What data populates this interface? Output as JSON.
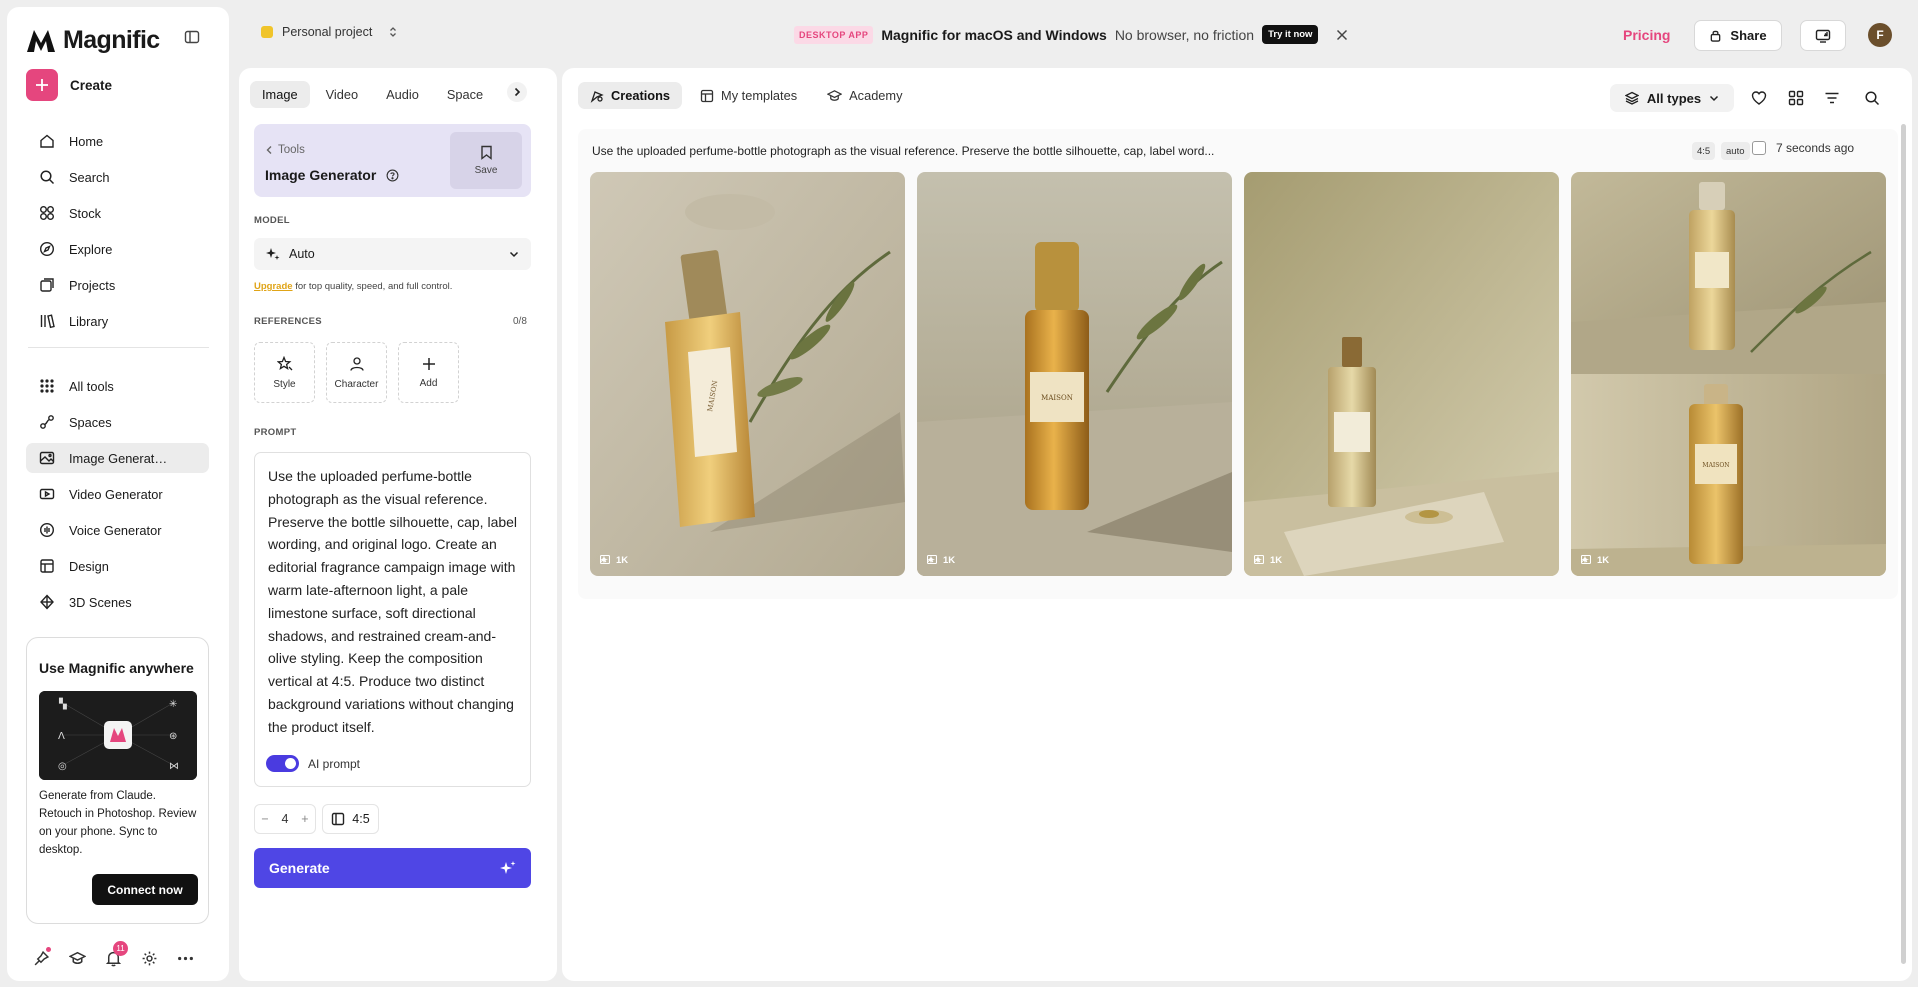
{
  "app": {
    "name": "Magnific",
    "create_label": "Create"
  },
  "sidebar": {
    "nav_primary": [
      {
        "label": "Home",
        "icon": "home-icon"
      },
      {
        "label": "Search",
        "icon": "search-icon"
      },
      {
        "label": "Stock",
        "icon": "stock-icon"
      },
      {
        "label": "Explore",
        "icon": "explore-icon"
      },
      {
        "label": "Projects",
        "icon": "projects-icon"
      },
      {
        "label": "Library",
        "icon": "library-icon"
      }
    ],
    "nav_secondary": [
      {
        "label": "All tools",
        "icon": "grid-icon"
      },
      {
        "label": "Spaces",
        "icon": "spaces-icon"
      },
      {
        "label": "Image Generat…",
        "icon": "image-icon",
        "active": true
      },
      {
        "label": "Video Generator",
        "icon": "video-icon"
      },
      {
        "label": "Voice Generator",
        "icon": "voice-icon"
      },
      {
        "label": "Design",
        "icon": "design-icon"
      },
      {
        "label": "3D Scenes",
        "icon": "3d-icon"
      }
    ],
    "promo": {
      "title": "Use Magnific anywhere",
      "text": "Generate from Claude. Retouch in Photoshop. Review on your phone. Sync to desktop.",
      "button": "Connect now"
    },
    "notifications_count": "11"
  },
  "topbar": {
    "project": "Personal project",
    "banner_tag": "DESKTOP APP",
    "banner_title": "Magnific for macOS and Windows",
    "banner_sub": "No browser, no friction",
    "banner_cta": "Try it now",
    "pricing": "Pricing",
    "share": "Share",
    "avatar_initial": "F"
  },
  "tools": {
    "tabs": [
      "Image",
      "Video",
      "Audio",
      "Spaces"
    ],
    "active_tab": "Image",
    "breadcrumb": "Tools",
    "tool_name": "Image Generator",
    "save": "Save",
    "model_label": "MODEL",
    "model_value": "Auto",
    "upgrade_link": "Upgrade",
    "upgrade_text": "for top quality, speed, and full control.",
    "references_label": "REFERENCES",
    "references_count": "0/8",
    "references": [
      "Style",
      "Character",
      "Add"
    ],
    "prompt_label": "PROMPT",
    "prompt_text": "Use the uploaded perfume-bottle photograph as the visual reference. Preserve the bottle silhouette, cap, label wording, and original logo. Create an editorial fragrance campaign image with warm late-afternoon light, a pale limestone surface, soft directional shadows, and restrained cream-and-olive styling. Keep the composition vertical at 4:5. Produce two distinct background variations without changing the product itself.",
    "ai_prompt": "AI prompt",
    "ai_prompt_on": true,
    "count": "4",
    "ratio": "4:5",
    "generate": "Generate"
  },
  "main": {
    "tabs": [
      "Creations",
      "My templates",
      "Academy"
    ],
    "active_tab": "Creations",
    "filter": "All types",
    "generation": {
      "prompt_preview": "Use the uploaded perfume-bottle photograph as the visual reference. Preserve the bottle silhouette, cap, label word...",
      "ratio_pill": "4:5",
      "mode_pill": "auto",
      "time": "7 seconds ago",
      "images": [
        {
          "resolution": "1K"
        },
        {
          "resolution": "1K"
        },
        {
          "resolution": "1K"
        },
        {
          "resolution": "1K"
        }
      ]
    }
  },
  "colors": {
    "accent": "#e5467e",
    "primary": "#4f46e5",
    "tool_card": "#e6e3f5"
  }
}
